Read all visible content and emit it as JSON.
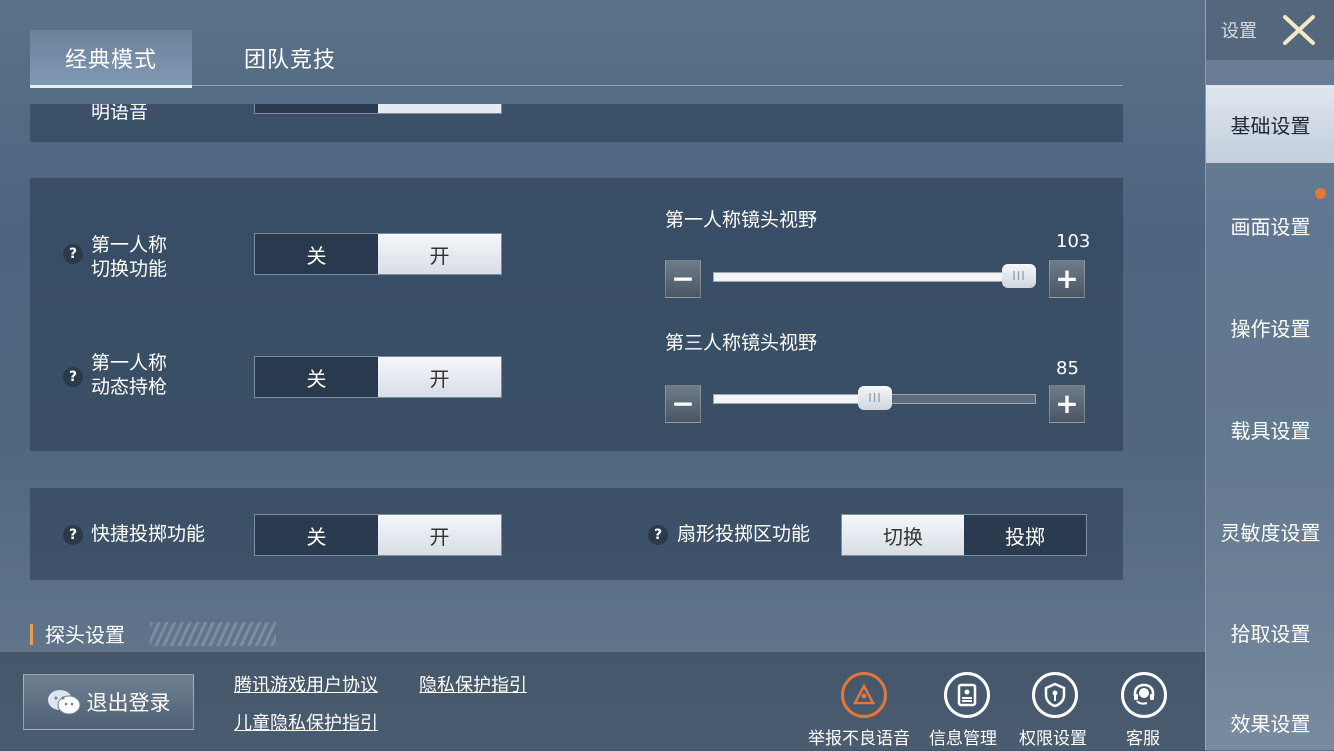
{
  "tabs": [
    {
      "label": "经典模式"
    },
    {
      "label": "团队竞技"
    }
  ],
  "partial_row": {
    "label": "明语音"
  },
  "panel1": {
    "row1": {
      "q": "?",
      "label_line1": "第一人称",
      "label_line2": "切换功能",
      "off": "关",
      "on": "开"
    },
    "row2": {
      "q": "?",
      "label_line1": "第一人称",
      "label_line2": "动态持枪",
      "off": "关",
      "on": "开"
    },
    "slider1": {
      "title": "第一人称镜头视野",
      "value": "103",
      "fraction": 0.95,
      "minus": "−",
      "plus": "+"
    },
    "slider2": {
      "title": "第三人称镜头视野",
      "value": "85",
      "fraction": 0.5,
      "minus": "−",
      "plus": "+"
    }
  },
  "panel2": {
    "row": {
      "q": "?",
      "label": "快捷投掷功能",
      "off": "关",
      "on": "开"
    },
    "fan": {
      "q": "?",
      "label": "扇形投掷区功能",
      "opt1": "切换",
      "opt2": "投掷"
    }
  },
  "section": {
    "title": "探头设置"
  },
  "sidebar": {
    "header": "设置",
    "items": [
      {
        "label": "基础设置"
      },
      {
        "label": "画面设置"
      },
      {
        "label": "操作设置"
      },
      {
        "label": "载具设置"
      },
      {
        "label": "灵敏度设置"
      },
      {
        "label": "拾取设置"
      },
      {
        "label": "效果设置"
      }
    ]
  },
  "footer": {
    "logout": "退出登录",
    "link1": "腾讯游戏用户协议",
    "link2": "隐私保护指引",
    "link3": "儿童隐私保护指引",
    "icons": [
      {
        "label": "举报不良语音",
        "icon": "report-voice-icon"
      },
      {
        "label": "信息管理",
        "icon": "id-card-icon"
      },
      {
        "label": "权限设置",
        "icon": "shield-icon"
      },
      {
        "label": "客服",
        "icon": "headset-icon"
      }
    ]
  },
  "colors": {
    "accent": "#e8a050",
    "notification": "#e2773a"
  }
}
